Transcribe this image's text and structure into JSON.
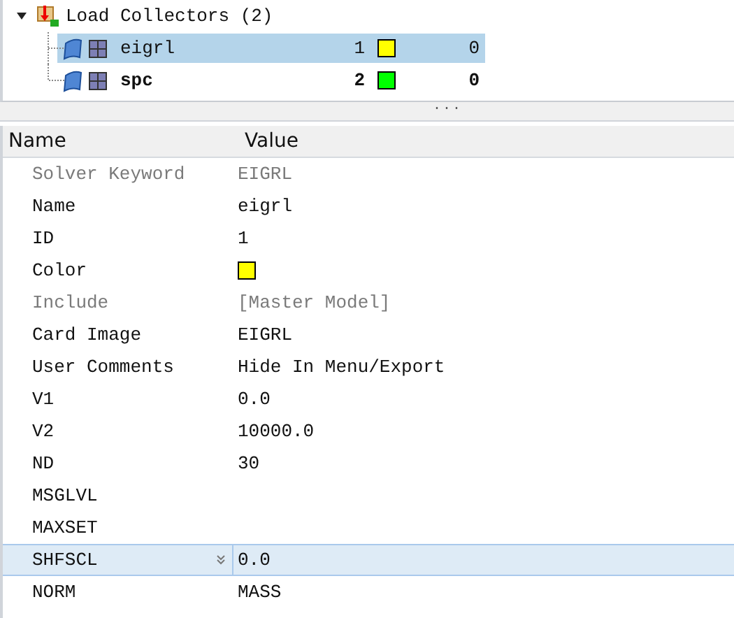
{
  "tree": {
    "root": {
      "label": "Load Collectors (2)",
      "expanded": true
    },
    "items": [
      {
        "name": "eigrl",
        "id": "1",
        "color": "#ffff00",
        "count": "0",
        "selected": true,
        "bold": false
      },
      {
        "name": "spc",
        "id": "2",
        "color": "#00ff00",
        "count": "0",
        "selected": false,
        "bold": true
      }
    ]
  },
  "splitter": {
    "grip": "..."
  },
  "properties": {
    "columns": [
      "Name",
      "Value"
    ],
    "rows": [
      {
        "name": "Solver Keyword",
        "kind": "text",
        "value": "EIGRL",
        "disabled": true,
        "selected": false
      },
      {
        "name": "Name",
        "kind": "text",
        "value": "eigrl",
        "disabled": false,
        "selected": false
      },
      {
        "name": "ID",
        "kind": "text",
        "value": "1",
        "disabled": false,
        "selected": false
      },
      {
        "name": "Color",
        "kind": "color",
        "color": "#ffff00",
        "disabled": false,
        "selected": false
      },
      {
        "name": "Include",
        "kind": "text",
        "value": "[Master Model]",
        "disabled": true,
        "selected": false
      },
      {
        "name": "Card Image",
        "kind": "text",
        "value": "EIGRL",
        "disabled": false,
        "selected": false
      },
      {
        "name": "User Comments",
        "kind": "text",
        "value": "Hide In Menu/Export",
        "disabled": false,
        "selected": false
      },
      {
        "name": "V1",
        "kind": "text",
        "value": "0.0",
        "disabled": false,
        "selected": false
      },
      {
        "name": "V2",
        "kind": "text",
        "value": "10000.0",
        "disabled": false,
        "selected": false
      },
      {
        "name": "ND",
        "kind": "text",
        "value": "30",
        "disabled": false,
        "selected": false
      },
      {
        "name": "MSGLVL",
        "kind": "text",
        "disabled": false,
        "selected": false
      },
      {
        "name": "MAXSET",
        "kind": "text",
        "disabled": false,
        "selected": false
      },
      {
        "name": "SHFSCL",
        "kind": "text",
        "value": "0.0",
        "disabled": false,
        "selected": true
      },
      {
        "name": "NORM",
        "kind": "text",
        "value": "MASS",
        "disabled": false,
        "selected": false
      }
    ]
  }
}
